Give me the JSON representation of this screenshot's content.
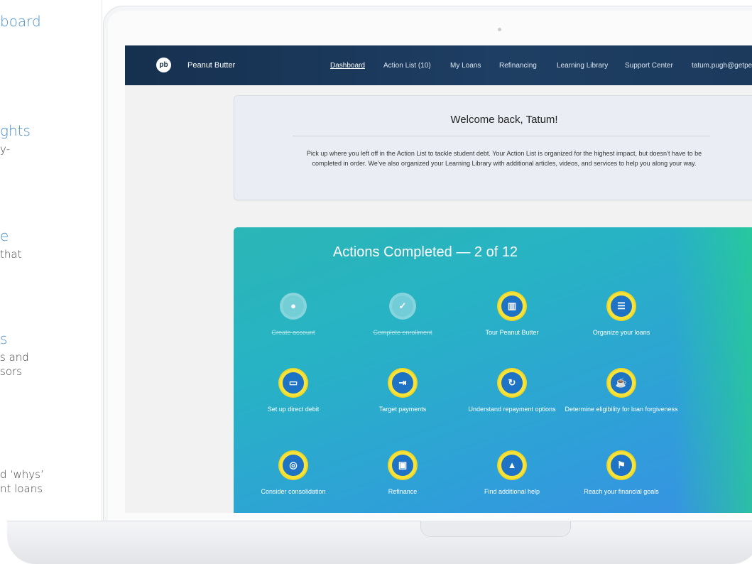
{
  "left_panel": {
    "features": [
      {
        "title": "board",
        "desc": ""
      },
      {
        "title": "ghts",
        "desc": "y-"
      },
      {
        "title": "e",
        "desc": "that"
      },
      {
        "title": "s",
        "desc": "s and\nsors"
      },
      {
        "title": "",
        "desc": "d ‘whys’\nnt loans"
      }
    ]
  },
  "nav": {
    "logo": "pb",
    "brand": "Peanut Butter",
    "items": [
      "Dashboard",
      "Action List (10)",
      "My Loans",
      "Refinancing",
      "Learning Library",
      "Support Center",
      "tatum.pugh@getpe"
    ]
  },
  "welcome": {
    "title": "Welcome back, Tatum!",
    "body": "Pick up where you left off in the Action List to tackle student debt. Your Action List is organized for the highest impact, but doesn’t have to be completed in order. We’ve also organized your Learning Library with additional articles, videos, and services to help you along your way."
  },
  "actions": {
    "title": "Actions Completed — 2 of 12",
    "items": [
      {
        "label": "Create account",
        "icon": "person-icon",
        "glyph": "●",
        "done": true
      },
      {
        "label": "Complete enrollment",
        "icon": "clipboard-check-icon",
        "glyph": "✓",
        "done": true
      },
      {
        "label": "Tour Peanut Butter",
        "icon": "map-icon",
        "glyph": "▥",
        "done": false
      },
      {
        "label": "Organize your loans",
        "icon": "list-icon",
        "glyph": "☰",
        "done": false
      },
      {
        "label": "Set up direct debit",
        "icon": "card-icon",
        "glyph": "▭",
        "done": false
      },
      {
        "label": "Target payments",
        "icon": "enter-icon",
        "glyph": "⇥",
        "done": false
      },
      {
        "label": "Understand repayment options",
        "icon": "refresh-icon",
        "glyph": "↻",
        "done": false
      },
      {
        "label": "Determine eligibility for loan forgiveness",
        "icon": "cup-icon",
        "glyph": "☕",
        "done": false
      },
      {
        "label": "Consider consolidation",
        "icon": "target-icon",
        "glyph": "◎",
        "done": false
      },
      {
        "label": "Refinance",
        "icon": "briefcase-icon",
        "glyph": "▣",
        "done": false
      },
      {
        "label": "Find additional help",
        "icon": "graduation-cap-icon",
        "glyph": "▲",
        "done": false
      },
      {
        "label": "Reach your financial goals",
        "icon": "flag-icon",
        "glyph": "⚑",
        "done": false
      }
    ]
  }
}
